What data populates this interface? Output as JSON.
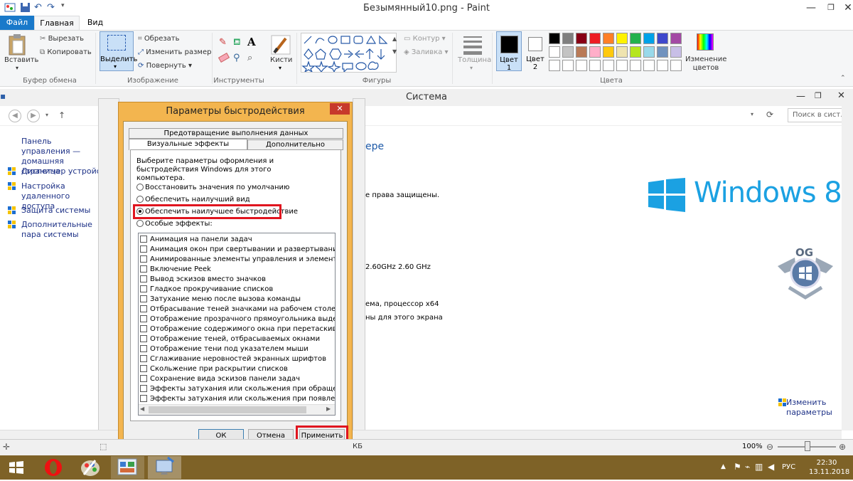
{
  "paint": {
    "title": "Безымянный10.png - Paint",
    "tabs": {
      "file": "Файл",
      "home": "Главная",
      "view": "Вид"
    },
    "clipboard": {
      "paste": "Вставить",
      "cut": "Вырезать",
      "copy": "Копировать",
      "label": "Буфер обмена"
    },
    "image": {
      "select": "Выделить",
      "crop": "Обрезать",
      "resize": "Изменить размер",
      "rotate": "Повернуть",
      "label": "Изображение"
    },
    "tools": {
      "label": "Инструменты",
      "brushes": "Кисти"
    },
    "shapes": {
      "outline": "Контур",
      "fill": "Заливка",
      "label": "Фигуры",
      "thickness": "Толщина"
    },
    "colors": {
      "color1": "Цвет 1",
      "color2": "Цвет 2",
      "edit": "Изменение цветов",
      "label": "Цвета",
      "palette": [
        "#000000",
        "#7f7f7f",
        "#880015",
        "#ed1c24",
        "#ff7f27",
        "#fff200",
        "#22b14c",
        "#00a2e8",
        "#3f48cc",
        "#a349a4",
        "#ffffff",
        "#c3c3c3",
        "#b97a57",
        "#ffaec9",
        "#ffc90e",
        "#efe4b0",
        "#b5e61d",
        "#99d9ea",
        "#7092be",
        "#c8bfe7"
      ]
    },
    "zoom": "100%",
    "status_size": "КБ"
  },
  "system": {
    "title": "Система",
    "search_placeholder": "Поиск в сист...",
    "left_nav": {
      "home": "Панель управления — домашняя страница",
      "device_manager": "Диспетчер устройств",
      "remote": "Настройка удаленного доступа",
      "protection": "Защита системы",
      "advanced": "Дополнительные пара системы"
    },
    "heading_fragment": "ере",
    "rights": "е права защищены.",
    "cpu": "2.60GHz   2.60 GHz",
    "os_type": "ема, процессор x64",
    "pen": "ны для этого экрана",
    "brand": "Windows 8",
    "change_params": "Изменить параметры"
  },
  "dialog": {
    "title": "Параметры быстродействия",
    "close_label": "✕",
    "tabs": {
      "dep": "Предотвращение выполнения данных",
      "visual": "Визуальные эффекты",
      "advanced": "Дополнительно"
    },
    "description": "Выберите параметры оформления и быстродействия Windows для этого компьютера.",
    "radios": [
      "Восстановить значения по умолчанию",
      "Обеспечить наилучший вид",
      "Обеспечить наилучшее быстродействие",
      "Особые эффекты:"
    ],
    "effects": [
      "Анимация на панели задач",
      "Анимация окон при свертывании и развертывании",
      "Анимированные элементы управления и элементы внутри",
      "Включение Peek",
      "Вывод эскизов вместо значков",
      "Гладкое прокручивание списков",
      "Затухание меню после вызова команды",
      "Отбрасывание теней значками на рабочем столе",
      "Отображение прозрачного прямоугольника выделения",
      "Отображение содержимого окна при перетаскивании",
      "Отображение теней, отбрасываемых окнами",
      "Отображение тени под указателем мыши",
      "Сглаживание неровностей экранных шрифтов",
      "Скольжение при раскрытии списков",
      "Сохранение вида эскизов панели задач",
      "Эффекты затухания или скольжения при обращении к ме",
      "Эффекты затухания или скольжения при появлении подс"
    ],
    "buttons": {
      "ok": "ОК",
      "cancel": "Отмена",
      "apply": "Применить"
    }
  },
  "taskbar": {
    "lang": "РУС",
    "time": "22:30",
    "date": "13.11.2018"
  },
  "colors": {
    "highlight": "#e0151f",
    "taskbar": "#7e6227",
    "dialog_frame": "#f3b54f",
    "accent": "#1979ca"
  }
}
